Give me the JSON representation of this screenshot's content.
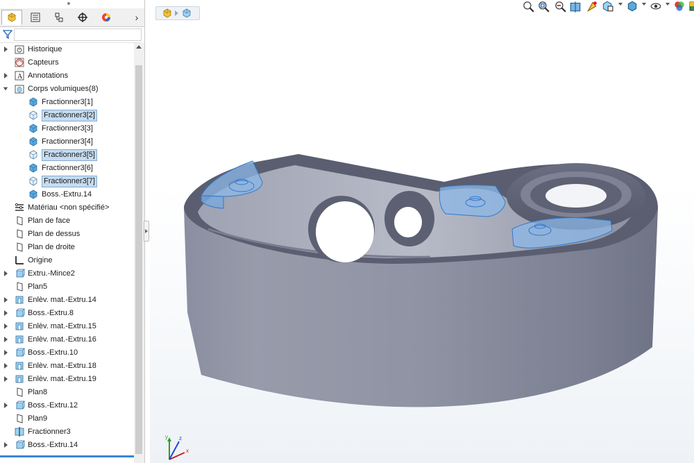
{
  "breadcrumb": {
    "items": [
      "part-icon",
      "body-icon"
    ]
  },
  "panel": {
    "tabs": [
      {
        "icon": "featuremanager-icon",
        "active": true
      },
      {
        "icon": "propertymanager-icon",
        "active": false
      },
      {
        "icon": "configurationmanager-icon",
        "active": false
      },
      {
        "icon": "dimxpert-icon",
        "active": false
      },
      {
        "icon": "displaymanager-icon",
        "active": false
      }
    ],
    "expand_label": "›",
    "filter_icon": "filter-icon"
  },
  "tree": [
    {
      "label": "Historique",
      "icon": "history-icon",
      "indent": 0,
      "expand": "collapsed"
    },
    {
      "label": "Capteurs",
      "icon": "sensor-icon",
      "indent": 0,
      "expand": "none"
    },
    {
      "label": "Annotations",
      "icon": "annotation-icon",
      "indent": 0,
      "expand": "collapsed"
    },
    {
      "label": "Corps volumiques(8)",
      "icon": "solid-bodies-folder-icon",
      "indent": 0,
      "expand": "expanded"
    },
    {
      "label": "Fractionner3[1]",
      "icon": "solid-body-icon",
      "indent": 1,
      "expand": "none",
      "selected": false
    },
    {
      "label": "Fractionner3[2]",
      "icon": "solid-body-outline-icon",
      "indent": 1,
      "expand": "none",
      "selected": true
    },
    {
      "label": "Fractionner3[3]",
      "icon": "solid-body-icon",
      "indent": 1,
      "expand": "none",
      "selected": false
    },
    {
      "label": "Fractionner3[4]",
      "icon": "solid-body-icon",
      "indent": 1,
      "expand": "none",
      "selected": false
    },
    {
      "label": "Fractionner3[5]",
      "icon": "solid-body-outline-icon",
      "indent": 1,
      "expand": "none",
      "selected": true
    },
    {
      "label": "Fractionner3[6]",
      "icon": "solid-body-icon",
      "indent": 1,
      "expand": "none",
      "selected": false
    },
    {
      "label": "Fractionner3[7]",
      "icon": "solid-body-outline-icon",
      "indent": 1,
      "expand": "none",
      "selected": true
    },
    {
      "label": "Boss.-Extru.14",
      "icon": "solid-body-icon",
      "indent": 1,
      "expand": "none",
      "selected": false
    },
    {
      "label": "Matériau <non spécifié>",
      "icon": "material-icon",
      "indent": 0,
      "expand": "none"
    },
    {
      "label": "Plan de face",
      "icon": "plane-icon",
      "indent": 0,
      "expand": "none"
    },
    {
      "label": "Plan de dessus",
      "icon": "plane-icon",
      "indent": 0,
      "expand": "none"
    },
    {
      "label": "Plan de droite",
      "icon": "plane-icon",
      "indent": 0,
      "expand": "none"
    },
    {
      "label": "Origine",
      "icon": "origin-icon",
      "indent": 0,
      "expand": "none"
    },
    {
      "label": "Extru.-Mince2",
      "icon": "boss-extrude-icon",
      "indent": 0,
      "expand": "collapsed"
    },
    {
      "label": "Plan5",
      "icon": "plane-icon",
      "indent": 0,
      "expand": "none"
    },
    {
      "label": "Enlèv. mat.-Extru.14",
      "icon": "cut-extrude-icon",
      "indent": 0,
      "expand": "collapsed"
    },
    {
      "label": "Boss.-Extru.8",
      "icon": "boss-extrude-icon",
      "indent": 0,
      "expand": "collapsed"
    },
    {
      "label": "Enlèv. mat.-Extru.15",
      "icon": "cut-extrude-icon",
      "indent": 0,
      "expand": "collapsed"
    },
    {
      "label": "Enlèv. mat.-Extru.16",
      "icon": "cut-extrude-icon",
      "indent": 0,
      "expand": "collapsed"
    },
    {
      "label": "Boss.-Extru.10",
      "icon": "boss-extrude-icon",
      "indent": 0,
      "expand": "collapsed"
    },
    {
      "label": "Enlèv. mat.-Extru.18",
      "icon": "cut-extrude-icon",
      "indent": 0,
      "expand": "collapsed"
    },
    {
      "label": "Enlèv. mat.-Extru.19",
      "icon": "cut-extrude-icon",
      "indent": 0,
      "expand": "collapsed"
    },
    {
      "label": "Plan8",
      "icon": "plane-icon",
      "indent": 0,
      "expand": "none"
    },
    {
      "label": "Boss.-Extru.12",
      "icon": "boss-extrude-icon",
      "indent": 0,
      "expand": "collapsed"
    },
    {
      "label": "Plan9",
      "icon": "plane-icon",
      "indent": 0,
      "expand": "none"
    },
    {
      "label": "Fractionner3",
      "icon": "split-icon",
      "indent": 0,
      "expand": "none"
    },
    {
      "label": "Boss.-Extru.14",
      "icon": "boss-extrude-icon",
      "indent": 0,
      "expand": "collapsed"
    }
  ],
  "heads_up_toolbar": [
    "zoom-to-fit-icon",
    "zoom-to-area-icon",
    "previous-view-icon",
    "section-view-icon",
    "dynamic-annotation-icon",
    "view-orientation-icon",
    "display-style-icon",
    "hide-show-items-icon",
    "appearance-icon",
    "scene-icon"
  ],
  "triad": {
    "x_label": "x",
    "y_label": "y",
    "z_label": "z"
  },
  "colors": {
    "selection_fill": "#c5dcf0",
    "selection_border": "#84acd0",
    "model_gray": "#8e93a3",
    "highlight_blue": "#4a90e2"
  }
}
